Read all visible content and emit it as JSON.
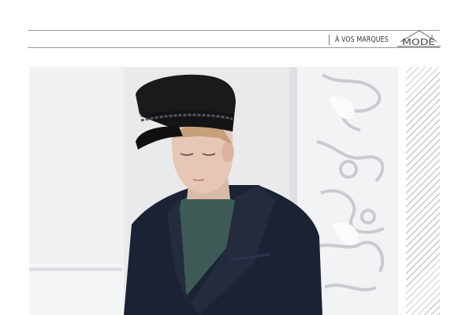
{
  "header": {
    "section_label": "À VOS MARQUES",
    "brand_logo": "MODE"
  },
  "icons": {
    "logo": "mode-house-logo"
  },
  "colors": {
    "rule": "#9a9a9a",
    "jacket": "#1b2233",
    "cap": "#1a1a1c",
    "sweater": "#3e5a56",
    "background": "#e9eaec"
  }
}
